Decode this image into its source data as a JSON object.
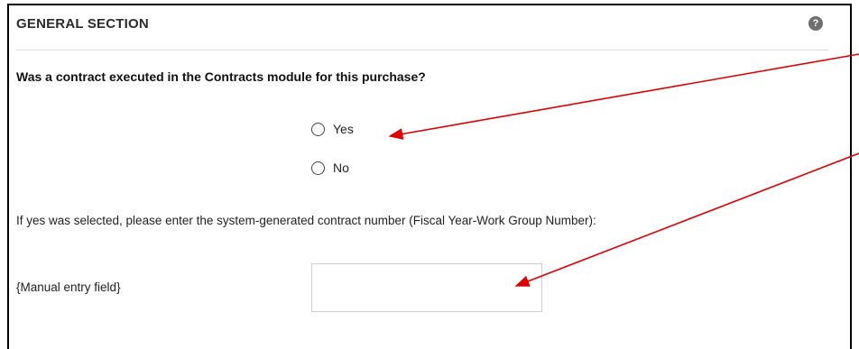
{
  "section": {
    "title": "GENERAL SECTION",
    "help_icon": "question-circle-icon"
  },
  "question": {
    "text": "Was a contract executed in the Contracts module for this purchase?",
    "options": [
      {
        "label": "Yes",
        "selected": false
      },
      {
        "label": "No",
        "selected": false
      }
    ]
  },
  "contract_number": {
    "instruction": "If yes was selected, please enter the system-generated contract number (Fiscal Year-Work Group Number):",
    "field_label": "{Manual entry field}",
    "value": ""
  },
  "annotations": {
    "arrow_color": "#e00000"
  }
}
